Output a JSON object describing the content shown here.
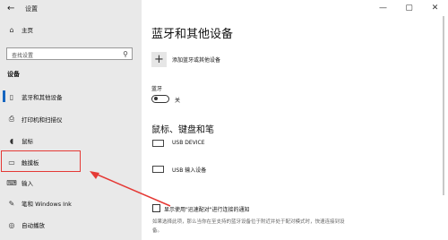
{
  "window": {
    "title": "设置",
    "controls": [
      "—",
      "▢",
      "✕"
    ]
  },
  "sidebar": {
    "home": "主页",
    "search_placeholder": "查找设置",
    "section": "设备",
    "items": [
      {
        "label": "蓝牙和其他设备",
        "icon": "bluetooth-icon"
      },
      {
        "label": "打印机和扫描仪",
        "icon": "printer-icon"
      },
      {
        "label": "鼠标",
        "icon": "mouse-icon"
      },
      {
        "label": "触摸板",
        "icon": "touchpad-icon"
      },
      {
        "label": "输入",
        "icon": "keyboard-icon"
      },
      {
        "label": "笔和 Windows Ink",
        "icon": "pen-icon"
      },
      {
        "label": "自动播放",
        "icon": "autoplay-icon"
      }
    ]
  },
  "main": {
    "heading": "蓝牙和其他设备",
    "add_device": "添加蓝牙或其他设备",
    "bluetooth_label": "蓝牙",
    "bluetooth_state": "关",
    "subheading": "鼠标、键盘和笔",
    "devices": [
      {
        "name": "USB DEVICE",
        "icon": "keyboard-device-icon"
      },
      {
        "name": "USB 输入设备",
        "icon": "keyboard-device-icon"
      }
    ],
    "checkbox_label": "显示使用\"迅速配对\"进行连接的通知",
    "description": "如果选择此项，那么当你在至支持的蓝牙设备位于附近并处于配对模式时，快速连接到设备。"
  },
  "colors": {
    "sidebar_bg": "#e9e9e9",
    "accent": "#1565c0",
    "annotation": "#e53935"
  }
}
